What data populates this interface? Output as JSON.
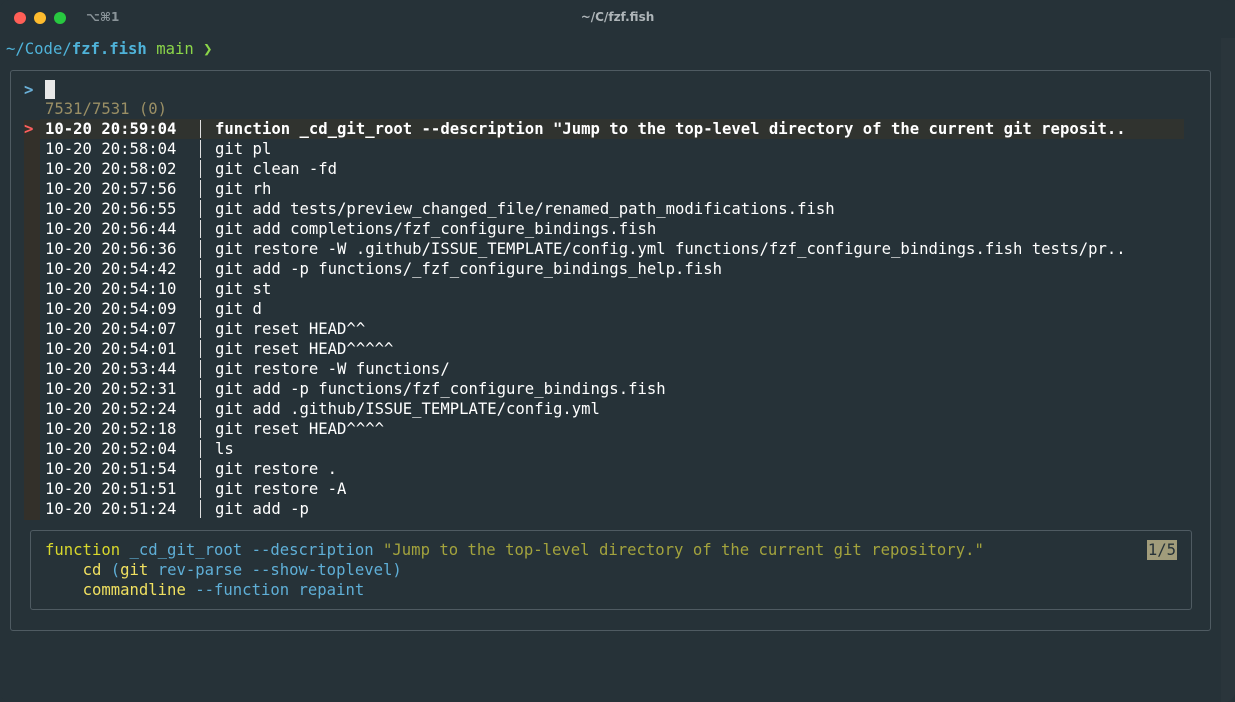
{
  "window": {
    "tab_shortcut": "⌥⌘1",
    "title": "~/C/fzf.fish"
  },
  "prompt": {
    "path_prefix": "~/Code/",
    "dir": "fzf.fish",
    "branch": "main",
    "arrow": "❯"
  },
  "fzf": {
    "prompt_char": ">",
    "query": "",
    "match_count": "7531/7531 (0)",
    "pointer": ">",
    "rows": [
      {
        "time": "10-20 20:59:04",
        "cmd": "function _cd_git_root --description \"Jump to the top-level directory of the current git reposit..",
        "selected": true
      },
      {
        "time": "10-20 20:58:04",
        "cmd": "git pl"
      },
      {
        "time": "10-20 20:58:02",
        "cmd": "git clean -fd"
      },
      {
        "time": "10-20 20:57:56",
        "cmd": "git rh"
      },
      {
        "time": "10-20 20:56:55",
        "cmd": "git add tests/preview_changed_file/renamed_path_modifications.fish"
      },
      {
        "time": "10-20 20:56:44",
        "cmd": "git add completions/fzf_configure_bindings.fish"
      },
      {
        "time": "10-20 20:56:36",
        "cmd": "git restore -W .github/ISSUE_TEMPLATE/config.yml functions/fzf_configure_bindings.fish tests/pr.."
      },
      {
        "time": "10-20 20:54:42",
        "cmd": "git add -p functions/_fzf_configure_bindings_help.fish"
      },
      {
        "time": "10-20 20:54:10",
        "cmd": "git st"
      },
      {
        "time": "10-20 20:54:09",
        "cmd": "git d"
      },
      {
        "time": "10-20 20:54:07",
        "cmd": "git reset HEAD^^"
      },
      {
        "time": "10-20 20:54:01",
        "cmd": "git reset HEAD^^^^^"
      },
      {
        "time": "10-20 20:53:44",
        "cmd": "git restore -W functions/"
      },
      {
        "time": "10-20 20:52:31",
        "cmd": "git add -p functions/fzf_configure_bindings.fish"
      },
      {
        "time": "10-20 20:52:24",
        "cmd": "git add .github/ISSUE_TEMPLATE/config.yml"
      },
      {
        "time": "10-20 20:52:18",
        "cmd": "git reset HEAD^^^^"
      },
      {
        "time": "10-20 20:52:04",
        "cmd": "ls"
      },
      {
        "time": "10-20 20:51:54",
        "cmd": "git restore ."
      },
      {
        "time": "10-20 20:51:51",
        "cmd": "git restore -A"
      },
      {
        "time": "10-20 20:51:24",
        "cmd": "git add -p"
      }
    ]
  },
  "preview": {
    "page_indicator": "1/5",
    "line1": {
      "kw": "function",
      "name": "_cd_git_root",
      "opt": "--description",
      "str": "\"Jump to the top-level directory of the current git repository.\""
    },
    "line2": {
      "indent": "    ",
      "kw": "cd",
      "paren_open": "(",
      "git": "git",
      "rest": "rev-parse --show-toplevel",
      "paren_close": ")"
    },
    "line3": {
      "indent": "    ",
      "kw": "commandline",
      "opt": "--function",
      "arg": "repaint"
    }
  },
  "colors": {
    "background": "#263238",
    "pointer": "#ff5f5f",
    "cyan": "#4fb3d9",
    "green": "#8bd649",
    "yellow": "#d7d72c"
  }
}
